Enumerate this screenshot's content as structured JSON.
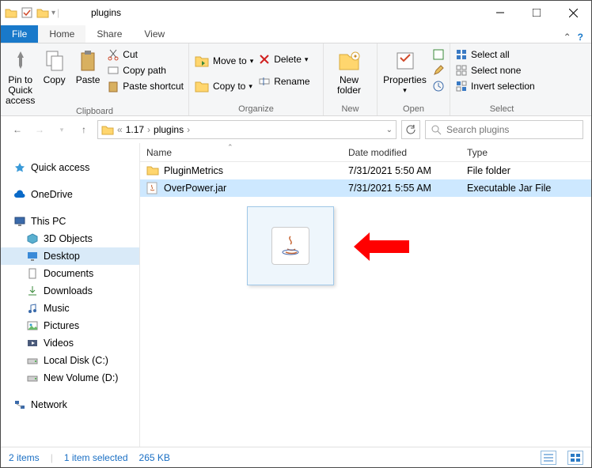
{
  "titlebar": {
    "title": "plugins"
  },
  "tabs": {
    "file": "File",
    "home": "Home",
    "share": "Share",
    "view": "View"
  },
  "ribbon": {
    "clipboard": {
      "label": "Clipboard",
      "pin": "Pin to Quick access",
      "copy": "Copy",
      "paste": "Paste",
      "cut": "Cut",
      "copypath": "Copy path",
      "pasteshortcut": "Paste shortcut"
    },
    "organize": {
      "label": "Organize",
      "moveto": "Move to",
      "copyto": "Copy to",
      "delete": "Delete",
      "rename": "Rename"
    },
    "new": {
      "label": "New",
      "newfolder": "New folder"
    },
    "open": {
      "label": "Open",
      "properties": "Properties"
    },
    "select": {
      "label": "Select",
      "all": "Select all",
      "none": "Select none",
      "invert": "Invert selection"
    }
  },
  "breadcrumb": {
    "parent": "1.17",
    "current": "plugins"
  },
  "search": {
    "placeholder": "Search plugins"
  },
  "columns": {
    "name": "Name",
    "date": "Date modified",
    "type": "Type"
  },
  "rows": [
    {
      "name": "PluginMetrics",
      "date": "7/31/2021 5:50 AM",
      "type": "File folder",
      "icon": "folder"
    },
    {
      "name": "OverPower.jar",
      "date": "7/31/2021 5:55 AM",
      "type": "Executable Jar File",
      "icon": "jar"
    }
  ],
  "nav": {
    "quick": "Quick access",
    "onedrive": "OneDrive",
    "thispc": "This PC",
    "items": [
      "3D Objects",
      "Desktop",
      "Documents",
      "Downloads",
      "Music",
      "Pictures",
      "Videos",
      "Local Disk (C:)",
      "New Volume (D:)"
    ],
    "network": "Network"
  },
  "status": {
    "count": "2 items",
    "selected": "1 item selected",
    "size": "265 KB"
  }
}
